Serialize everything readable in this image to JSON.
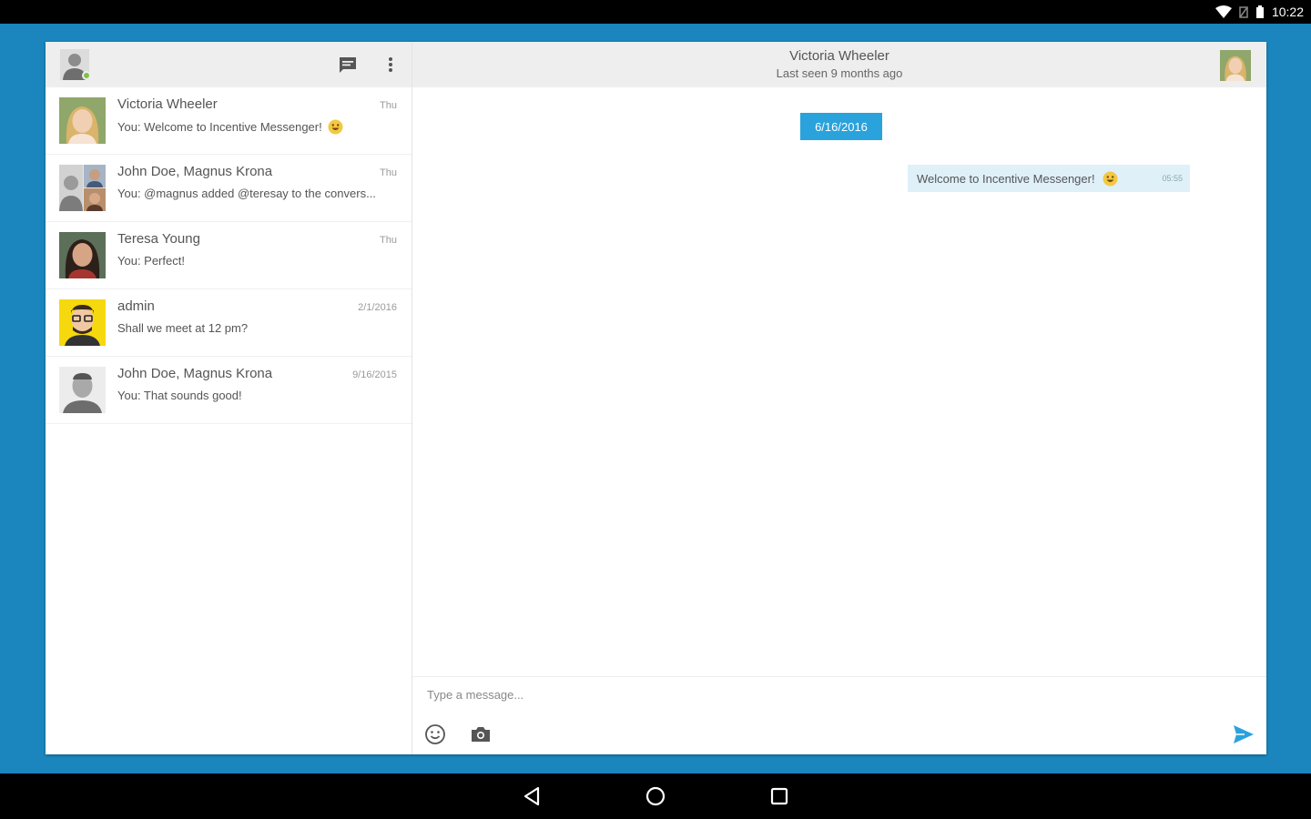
{
  "status_bar": {
    "time": "10:22"
  },
  "conversations": [
    {
      "name": "Victoria Wheeler",
      "time": "Thu",
      "preview": "You: Welcome to Incentive Messenger!",
      "emoji": true
    },
    {
      "name": "John Doe, Magnus Krona",
      "time": "Thu",
      "preview": "You: @magnus added @teresay to the convers..."
    },
    {
      "name": "Teresa Young",
      "time": "Thu",
      "preview": "You: Perfect!"
    },
    {
      "name": "admin",
      "time": "2/1/2016",
      "preview": "Shall we meet at 12 pm?"
    },
    {
      "name": "John Doe, Magnus Krona",
      "time": "9/16/2015",
      "preview": "You: That sounds good!"
    }
  ],
  "chat": {
    "name": "Victoria Wheeler",
    "status": "Last seen 9 months ago",
    "date_chip": "6/16/2016",
    "message": {
      "text": "Welcome to Incentive Messenger!",
      "time": "05:55"
    }
  },
  "composer": {
    "placeholder": "Type a message..."
  },
  "colors": {
    "accent": "#2aa2dc",
    "background": "#1a86bd",
    "presence": "#7fc241"
  }
}
